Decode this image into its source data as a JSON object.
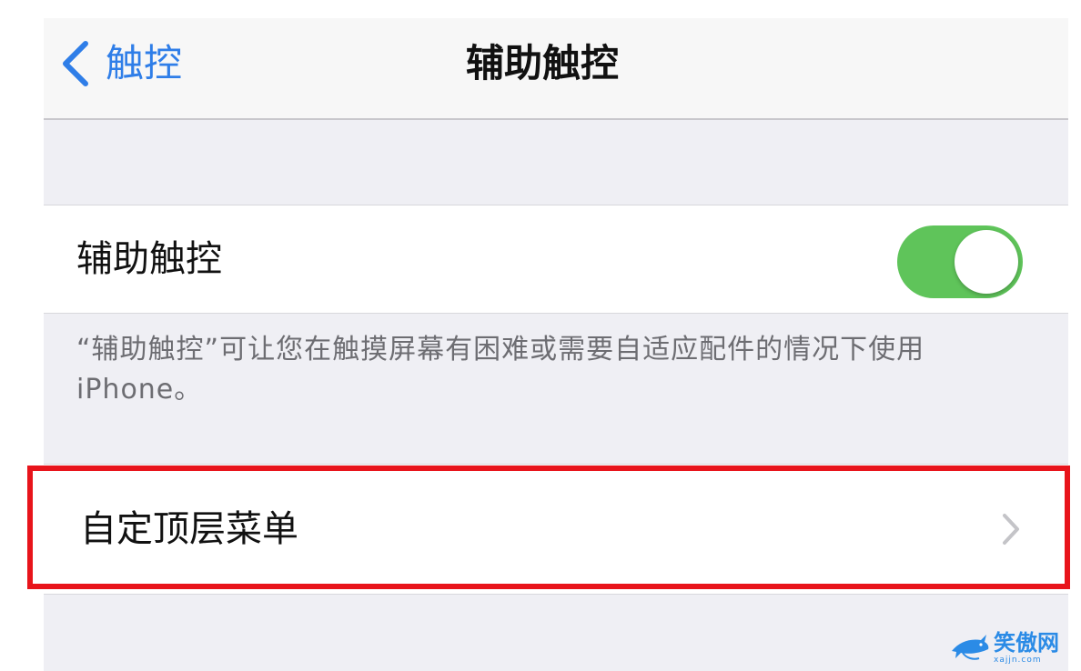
{
  "nav": {
    "back_label": "触控",
    "title": "辅助触控"
  },
  "assistive_touch": {
    "label": "辅助触控",
    "toggle_state": "on",
    "toggle_color": "#5fc45a"
  },
  "description": "“辅助触控”可让您在触摸屏幕有困难或需要自适应配件的情况下使用iPhone。",
  "menu": {
    "custom_top_menu_label": "自定顶层菜单"
  },
  "highlight": {
    "color": "#e8141b"
  },
  "watermark": {
    "name": "笑傲网",
    "domain": "xajjn.com"
  },
  "colors": {
    "accent": "#2f7ee8",
    "background": "#efeff4"
  },
  "icons": {
    "back": "chevron-left-icon",
    "row": "chevron-right-icon",
    "watermark": "shark-logo-icon"
  }
}
